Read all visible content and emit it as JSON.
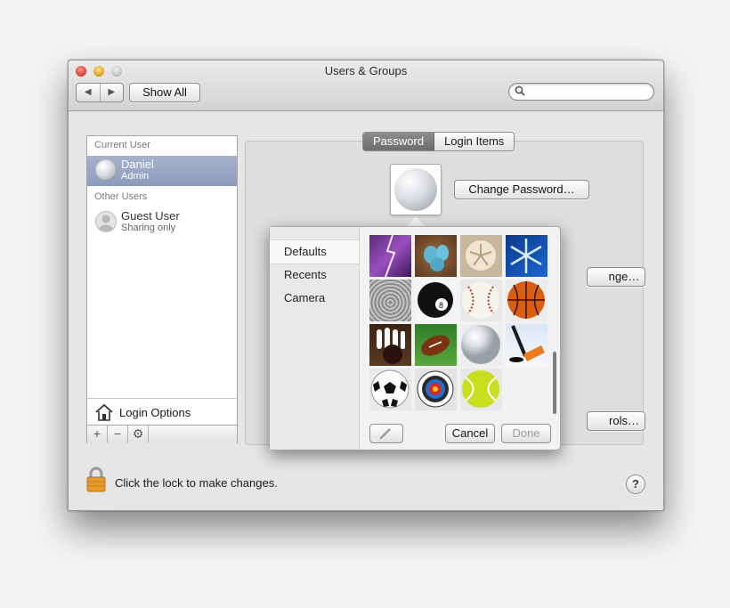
{
  "window": {
    "title": "Users & Groups"
  },
  "toolbar": {
    "back_label": "◀",
    "forward_label": "▶",
    "show_all_label": "Show All",
    "search_placeholder": ""
  },
  "sidebar": {
    "current_user_header": "Current User",
    "current_user": {
      "name": "Daniel",
      "role": "Admin"
    },
    "other_users_header": "Other Users",
    "other_users": [
      {
        "name": "Guest User",
        "role": "Sharing only"
      }
    ],
    "login_options_label": "Login Options",
    "add_label": "+",
    "remove_label": "−",
    "gear_label": "⚙"
  },
  "tabs": [
    {
      "label": "Password",
      "active": true
    },
    {
      "label": "Login Items",
      "active": false
    }
  ],
  "main": {
    "change_password_label": "Change Password…",
    "hidden_button_1_label": "nge…",
    "hidden_button_2_label": "rols…"
  },
  "picker": {
    "categories": [
      "Defaults",
      "Recents",
      "Camera"
    ],
    "selected_category": "Defaults",
    "images": [
      "lightning",
      "eggs",
      "sand-dollar",
      "snowflake",
      "zen-stones",
      "8-ball",
      "baseball",
      "basketball",
      "bowling",
      "football",
      "golf-ball",
      "hockey",
      "soccer-ball",
      "target",
      "tennis-ball"
    ],
    "cancel_label": "Cancel",
    "done_label": "Done"
  },
  "footer": {
    "lock_text": "Click the lock to make changes.",
    "help_label": "?"
  },
  "colors": {
    "selection": "#8d9bbb",
    "tab_active": "#737373",
    "window_bg": "#e6e6e6"
  }
}
